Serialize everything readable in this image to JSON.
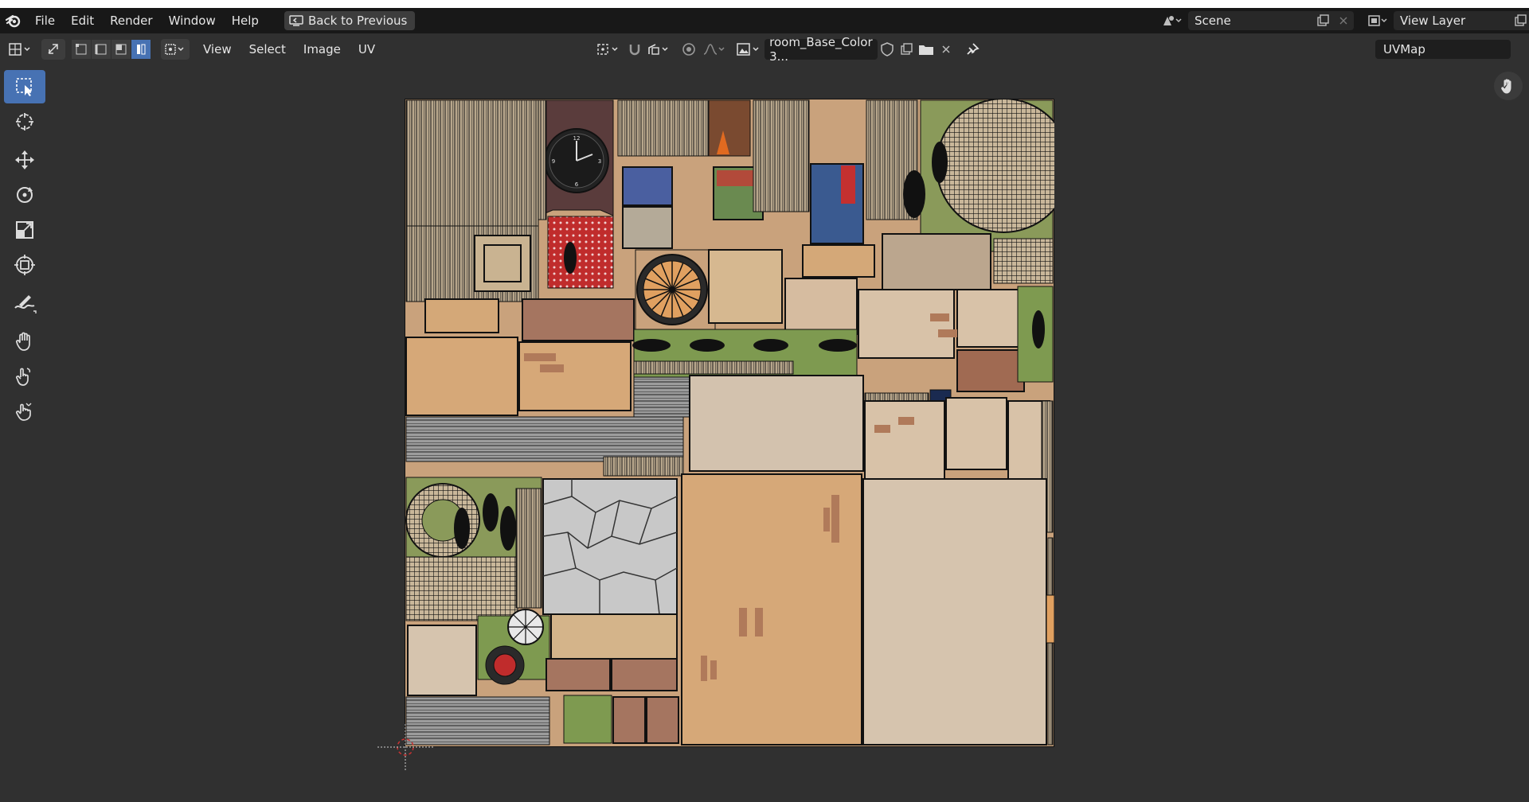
{
  "menubar": {
    "items": [
      "File",
      "Edit",
      "Render",
      "Window",
      "Help"
    ],
    "back_label": "Back to Previous",
    "scene": "Scene",
    "view_layer": "View Layer"
  },
  "header": {
    "menus": [
      "View",
      "Select",
      "Image",
      "UV"
    ],
    "image_name": "room_Base_Color 3...",
    "uvmap": "UVMap"
  },
  "texture": {
    "clock_numbers": [
      "12",
      "3",
      "6",
      "9"
    ]
  },
  "colors": {
    "accent": "#4772b3",
    "bg": "#303030",
    "header": "#181818"
  }
}
